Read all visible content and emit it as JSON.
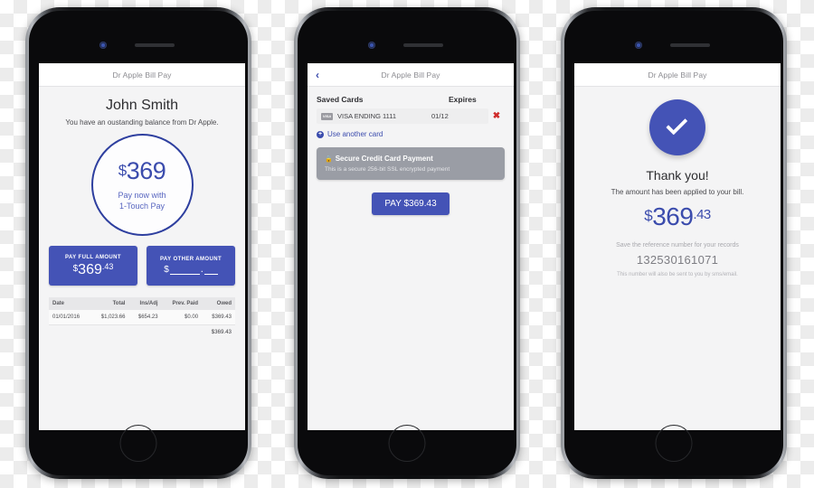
{
  "app": {
    "title": "Dr Apple Bill Pay",
    "accent_color": "#4453b6",
    "accent_text_color": "#3b4cad",
    "danger_color": "#cf2b2b"
  },
  "screen1": {
    "nav_title": "Dr Apple Bill Pay",
    "customer_name": "John Smith",
    "subtitle": "You have an oustanding balance from Dr Apple.",
    "circle": {
      "currency": "$",
      "amount": "369",
      "line1": "Pay now with",
      "line2": "1-Touch Pay"
    },
    "pay_full": {
      "label": "PAY FULL AMOUNT",
      "currency": "$",
      "dollars": "369",
      "cents": ".43"
    },
    "pay_other": {
      "label": "PAY OTHER AMOUNT",
      "currency": "$",
      "separator": "."
    },
    "table": {
      "headers": [
        "Date",
        "Total",
        "Ins/Adj",
        "Prev. Paid",
        "Owed"
      ],
      "rows": [
        [
          "01/01/2016",
          "$1,023.66",
          "$654.23",
          "$0.00",
          "$369.43"
        ]
      ],
      "total": "$369.43"
    }
  },
  "screen2": {
    "nav_title": "Dr Apple Bill Pay",
    "back_icon": "chevron-left",
    "headers": {
      "saved_cards": "Saved Cards",
      "expires": "Expires"
    },
    "cards": [
      {
        "brand": "VISA",
        "label": "VISA ENDING 1111",
        "expires": "01/12",
        "delete_icon": "✖"
      }
    ],
    "another_card_label": "Use another card",
    "secure": {
      "lock_icon": "🔒",
      "title": "Secure Credit Card Payment",
      "subtitle": "This is a secure 256-bit SSL encrypted payment"
    },
    "pay_button_label": "PAY $369.43"
  },
  "screen3": {
    "nav_title": "Dr Apple Bill Pay",
    "check_icon": "check-mark",
    "thank_you": "Thank you!",
    "applied_message": "The amount has been applied to your bill.",
    "paid": {
      "currency": "$",
      "dollars": "369",
      "cents": ".43"
    },
    "reference_label": "Save the reference number for your records",
    "reference_number": "132530161071",
    "reference_note": "This number will also be sent to you by sms/email."
  }
}
